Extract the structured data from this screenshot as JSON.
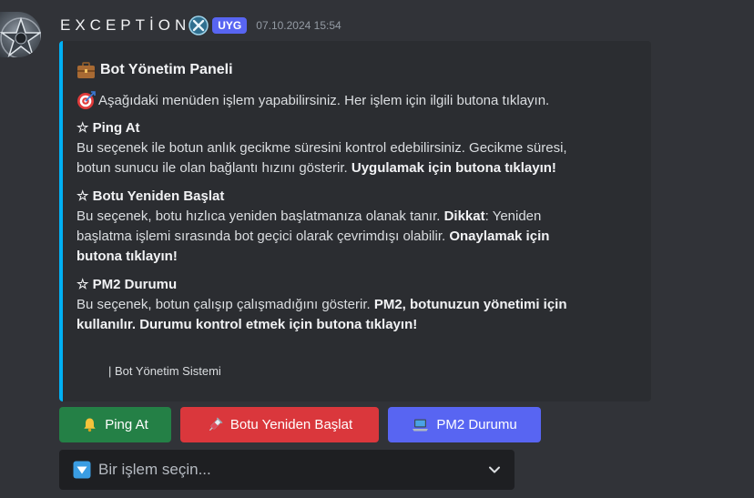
{
  "message": {
    "username": "EXCEPTİON",
    "tag": "UYG",
    "timestamp": "07.10.2024 15:54"
  },
  "embed": {
    "accent_color": "#00b0f4",
    "title": "Bot Yönetim Paneli",
    "title_icon": "briefcase-icon",
    "description": "Aşağıdaki menüden işlem yapabilirsiniz. Her işlem için ilgili butona tıklayın.",
    "description_icon": "target-icon",
    "fields": [
      {
        "name": "☆ Ping At",
        "value_line1": "Bu seçenek ile botun anlık gecikme süresini kontrol edebilirsiniz. Gecikme süresi,",
        "value_line2_plain": "botun sunucu ile olan bağlantı hızını gösterir. ",
        "value_line2_bold": "Uygulamak için butona tıklayın!"
      },
      {
        "name": "☆ Botu Yeniden Başlat",
        "value_line1_plain": "Bu seçenek, botu hızlıca yeniden başlatmanıza olanak tanır. ",
        "value_line1_bold": "Dikkat",
        "value_line1_tail": ": Yeniden",
        "value_line2_plain": "başlatma işlemi sırasında bot geçici olarak çevrimdışı olabilir. ",
        "value_line2_bold": "Onaylamak için",
        "value_line3_bold": "butona tıklayın!"
      },
      {
        "name": "☆ PM2 Durumu",
        "value_line1_plain": "Bu seçenek, botun çalışıp çalışmadığını gösterir. ",
        "value_line1_bold": "PM2, botunuzun yönetimi için",
        "value_line2_bold": "kullanılır. Durumu kontrol etmek için butona tıklayın!"
      }
    ],
    "footer": "| Bot Yönetim Sistemi"
  },
  "buttons": [
    {
      "label": "Ping At",
      "icon": "bell-icon",
      "color": "#248046"
    },
    {
      "label": "Botu Yeniden Başlat",
      "icon": "syringe-icon",
      "color": "#da373c"
    },
    {
      "label": "PM2 Durumu",
      "icon": "laptop-icon",
      "color": "#5865f2"
    }
  ],
  "select": {
    "placeholder": "Bir işlem seçin...",
    "icon": "arrow-down-box-icon"
  },
  "colors": {
    "background": "#313338",
    "embed_background": "#2b2d31",
    "tag": "#5865f2"
  }
}
